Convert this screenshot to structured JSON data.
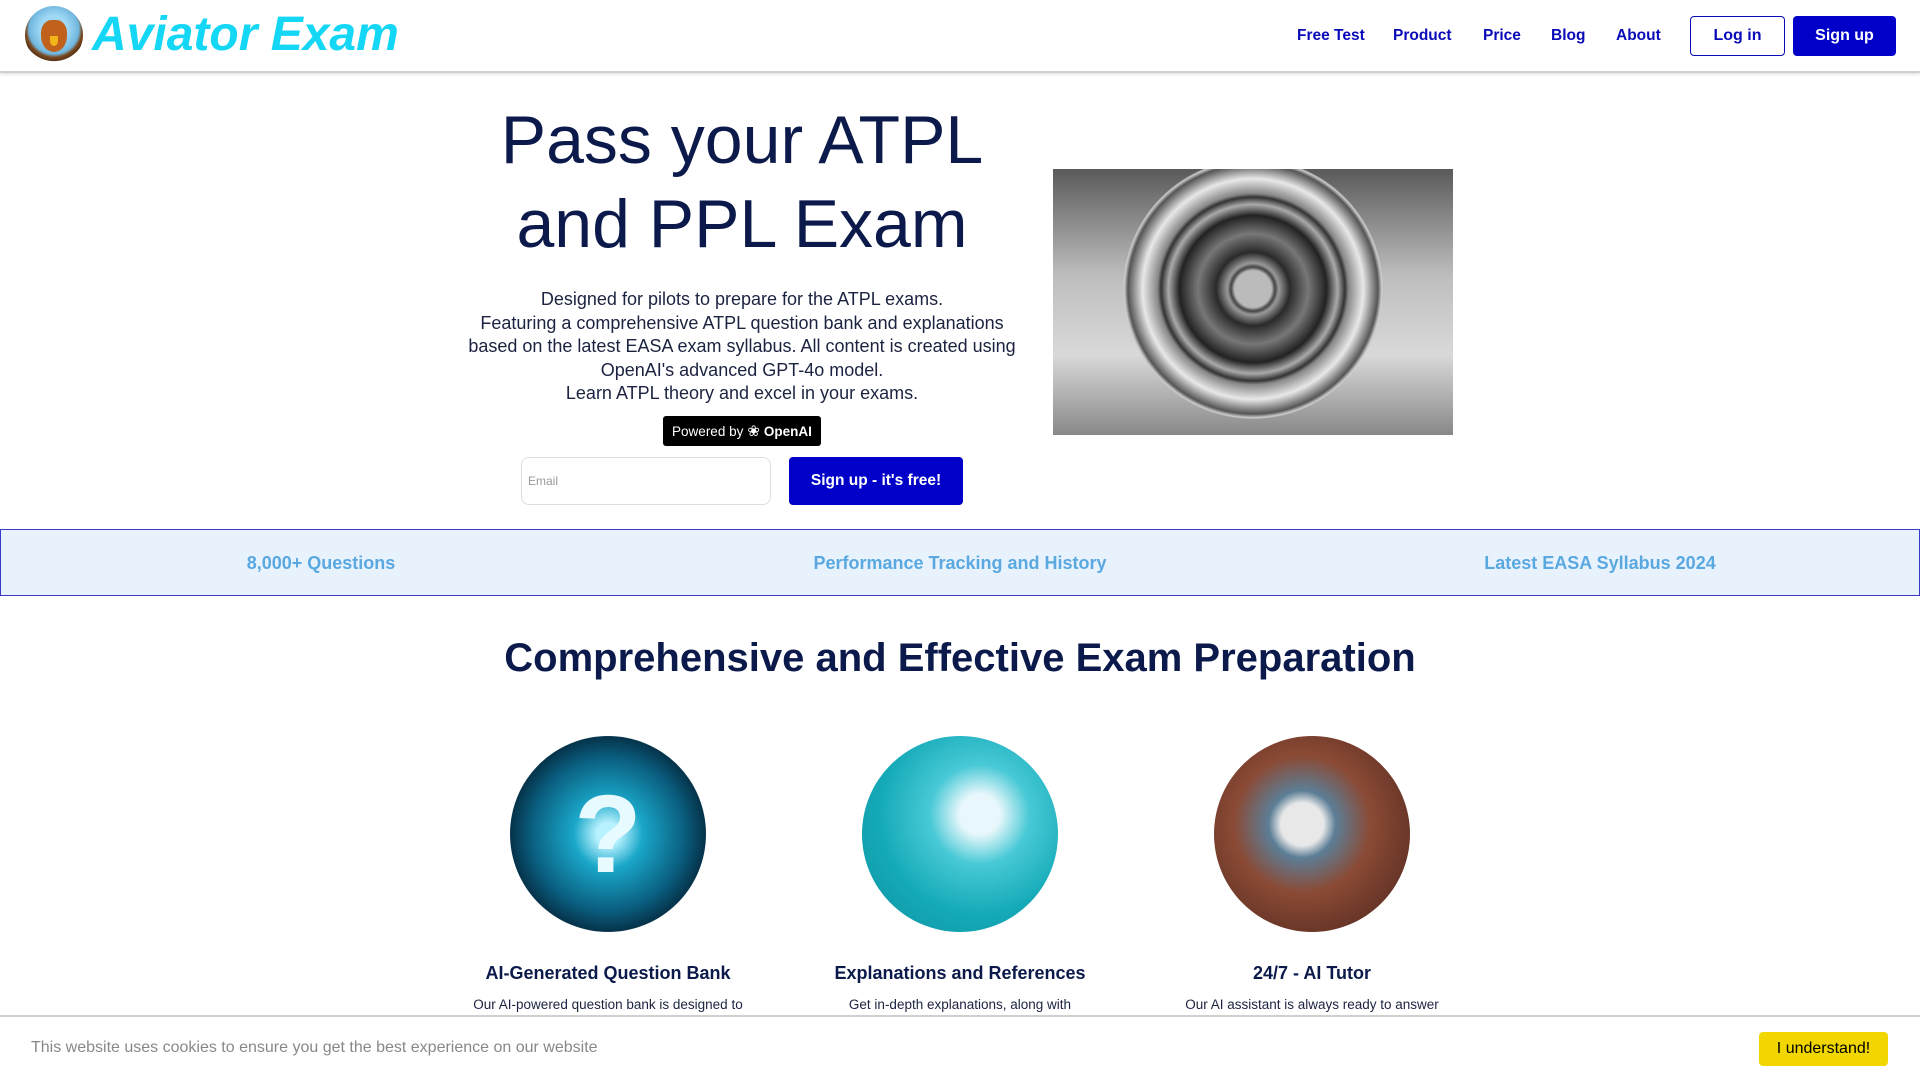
{
  "header": {
    "brand": "Aviator Exam",
    "nav": [
      "Free Test",
      "Product",
      "Price",
      "Blog",
      "About"
    ],
    "login": "Log in",
    "signup": "Sign up"
  },
  "hero": {
    "title_line1": "Pass your ATPL",
    "title_line2": "and PPL Exam",
    "paragraph": [
      "Designed for pilots to prepare for the ATPL exams.",
      "Featuring a comprehensive ATPL question bank and explanations",
      "based on the latest EASA exam syllabus. All content is created using",
      "OpenAI's advanced GPT-4o model.",
      "Learn ATPL theory and excel in your exams."
    ],
    "badge_prefix": "Powered by",
    "badge_brand": "OpenAI",
    "email_placeholder": "Email",
    "email_value": "",
    "cta": "Sign up - it's free!"
  },
  "features": [
    "8,000+ Questions",
    "Performance Tracking and History",
    "Latest EASA Syllabus 2024"
  ],
  "section": {
    "title": "Comprehensive and Effective Exam Preparation",
    "cards": [
      {
        "title": "AI-Generated Question Bank",
        "desc": "Our AI-powered question bank is designed to"
      },
      {
        "title": "Explanations and References",
        "desc": "Get in-depth explanations, along with"
      },
      {
        "title": "24/7 - AI Tutor",
        "desc": "Our AI assistant is always ready to answer"
      }
    ]
  },
  "cookie": {
    "text": "This website uses cookies to ensure you get the best experience on our website",
    "button": "I understand!"
  },
  "colors": {
    "brand": "#14d6f5",
    "primary": "#0000c8",
    "feature_text": "#5aa8e0",
    "cookie_button": "#f1d600"
  }
}
